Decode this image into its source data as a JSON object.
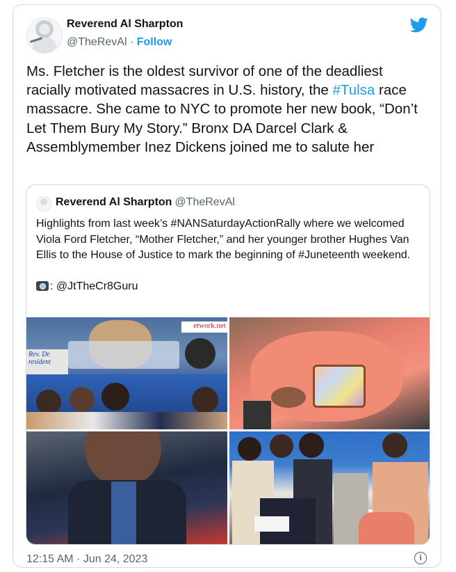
{
  "tweet": {
    "author_name": "Reverend Al Sharpton",
    "author_handle": "@TheRevAl",
    "separator": " · ",
    "follow_label": "Follow",
    "text_part1": "Ms. Fletcher is the oldest survivor of one of the deadliest racially motivated massacres in U.S. history, the ",
    "hashtag": "#Tulsa",
    "text_part2": " race massacre. She came to NYC to promote her new book, “Don’t Let Them Bury My Story.” Bronx DA Darcel Clark & Assemblymember Inez Dickens joined me to salute her",
    "timestamp": "12:15 AM · Jun 24, 2023",
    "brand_icon": "twitter-bird-icon",
    "info_icon": "info-icon"
  },
  "quoted": {
    "author_name": "Reverend Al Sharpton",
    "author_handle": "@TheRevAl",
    "text": "Highlights from last week’s #NANSaturdayActionRally where we welcomed Viola Ford Fletcher, “Mother Fletcher,” and her younger brother Hughes Van Ellis to the House of Justice to mark the beginning of #Juneteenth weekend.",
    "credit": ": @JtTheCr8Guru",
    "credit_icon": "camera-icon",
    "photo_texts": {
      "banner": "etwork.net",
      "podium": "Rev. Dr.\nresident"
    }
  },
  "colors": {
    "link": "#1d9bf0",
    "text": "#0f1419",
    "muted": "#536471",
    "border": "#cfd9de"
  }
}
